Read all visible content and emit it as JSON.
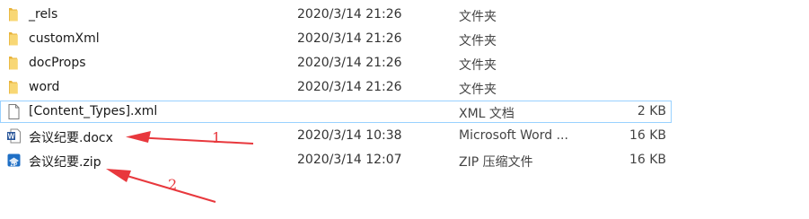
{
  "files": [
    {
      "name": "_rels",
      "date": "2020/3/14 21:26",
      "type": "文件夹",
      "size": "",
      "icon": "folder-icon"
    },
    {
      "name": "customXml",
      "date": "2020/3/14 21:26",
      "type": "文件夹",
      "size": "",
      "icon": "folder-icon"
    },
    {
      "name": "docProps",
      "date": "2020/3/14 21:26",
      "type": "文件夹",
      "size": "",
      "icon": "folder-icon"
    },
    {
      "name": "word",
      "date": "2020/3/14 21:26",
      "type": "文件夹",
      "size": "",
      "icon": "folder-icon"
    },
    {
      "name": "[Content_Types].xml",
      "date": "",
      "type": "XML 文档",
      "size": "2 KB",
      "icon": "xml-file-icon",
      "selected": true
    },
    {
      "name": "会议纪要.docx",
      "date": "2020/3/14 10:38",
      "type": "Microsoft Word ...",
      "size": "16 KB",
      "icon": "word-file-icon"
    },
    {
      "name": "会议纪要.zip",
      "date": "2020/3/14 12:07",
      "type": "ZIP 压缩文件",
      "size": "16 KB",
      "icon": "zip-file-icon"
    }
  ],
  "annotations": {
    "label_1": "1",
    "label_2": "2",
    "arrow_color": "#e8383d"
  },
  "colors": {
    "selection_border": "#99d1ff",
    "folder_yellow": "#f8d775",
    "word_blue": "#2b579a"
  }
}
